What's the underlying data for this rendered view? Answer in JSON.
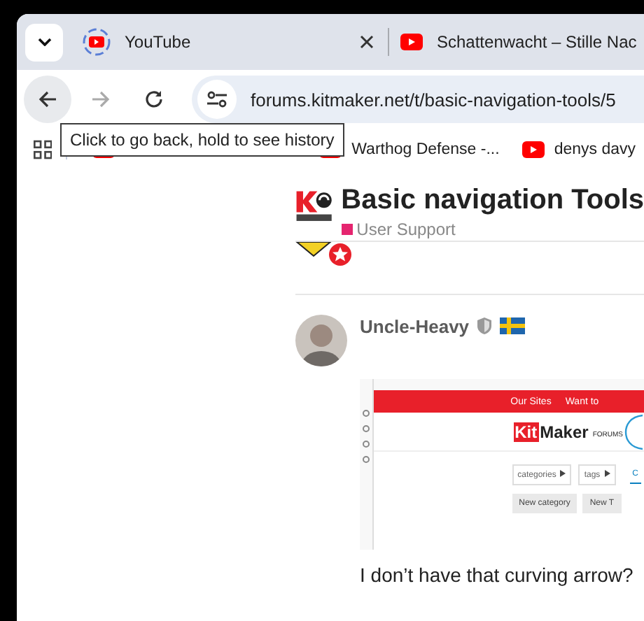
{
  "tab_strip": {
    "tabs": [
      {
        "title": "YouTube",
        "loading": true
      },
      {
        "title": "Schattenwacht – Stille Nac",
        "loading": false
      }
    ]
  },
  "toolbar": {
    "back_enabled": true,
    "forward_enabled": false,
    "url": "forums.kitmaker.net/t/basic-navigation-tools/5",
    "tooltip": "Click to go back, hold to see history"
  },
  "bookmarks": [
    {
      "title": "Warthog Defense -..."
    },
    {
      "title": "denys davy"
    }
  ],
  "topic": {
    "title": "Basic navigation Tools",
    "category": {
      "name": "User Support",
      "color": "#e5256f"
    }
  },
  "post": {
    "author": "Uncle-Heavy",
    "body": "I don’t have that curving arrow?",
    "screenshot": {
      "top_links": [
        "Our Sites",
        "Want to"
      ],
      "logo": {
        "kit": "Kit",
        "maker": "Maker",
        "forums": "FORUMS"
      },
      "filters": [
        "categories",
        "tags"
      ],
      "filter_tab": "C",
      "buttons": [
        "New category",
        "New T"
      ]
    }
  }
}
